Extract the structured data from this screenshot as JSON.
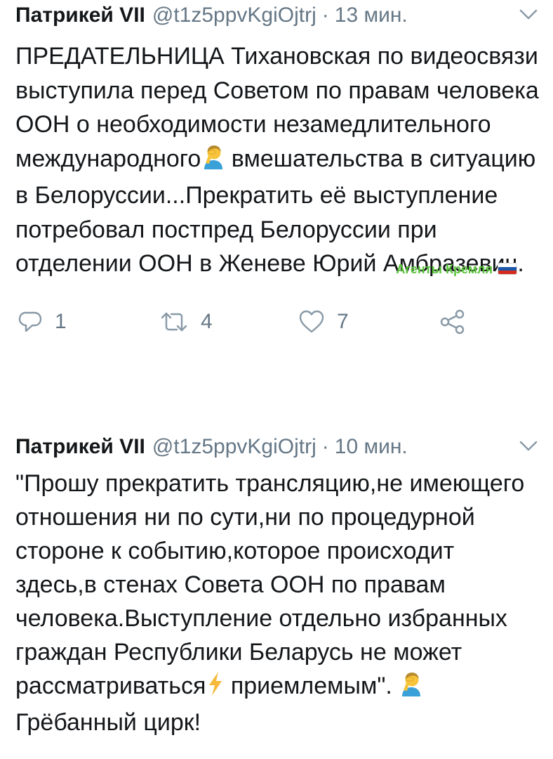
{
  "tweets": [
    {
      "author": "Патрикей VII",
      "handle": "@t1z5ppvKgiOjtrj",
      "separator": "·",
      "time": "13 мин.",
      "text_parts": [
        "ПРЕДАТЕЛЬНИЦА Тихановская по видеосвязи выступила перед Советом по правам человека ООН о необходимости незамедлительного международного",
        "вмешательства в ситуацию в Белоруссии...Прекратить её выступление потребовал постпред Белоруссии при отделении ООН в Женеве Юрий Амбразевич."
      ],
      "badge": {
        "label": "Агенты Кремля",
        "flag_colors": [
          "#ffffff",
          "#1c57a7",
          "#d52b1e"
        ]
      },
      "actions": {
        "reply_count": "1",
        "retweet_count": "4",
        "like_count": "7"
      }
    },
    {
      "author": "Патрикей VII",
      "handle": "@t1z5ppvKgiOjtrj",
      "separator": "·",
      "time": "10 мин.",
      "text_parts": [
        "\"Прошу прекратить трансляцию,не имеющего отношения ни по сути,ни по процедурной стороне к событию,которое происходит здесь,в стенах Совета ООН по правам человека.Выступление отдельно избранных граждан Республики Беларусь не может рассматриваться",
        "приемлемым\".",
        " Грёбанный цирк!"
      ]
    }
  ],
  "icons": {
    "menu": "chevron-down-icon",
    "reply": "reply-icon",
    "retweet": "retweet-icon",
    "like": "heart-icon",
    "share": "share-icon",
    "facepalm": "facepalm-emoji",
    "lightning": "high-voltage-emoji"
  },
  "colors": {
    "text": "#14171a",
    "secondary": "#657786",
    "badge": "#59c43a",
    "emoji_skin": "#f7c43b",
    "emoji_shirt": "#3aa0d8",
    "lightning": "#f6b93b"
  }
}
